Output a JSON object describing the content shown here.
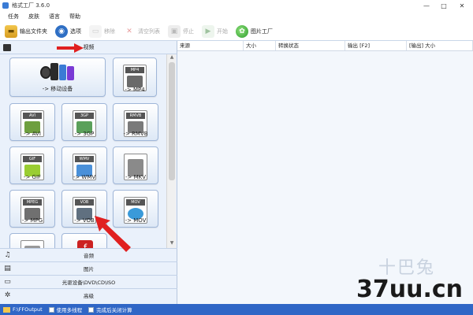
{
  "window": {
    "title": "格式工厂 3.6.0",
    "min_glyph": "—",
    "max_glyph": "□",
    "close_glyph": "✕"
  },
  "menu": [
    "任务",
    "皮肤",
    "语言",
    "帮助"
  ],
  "toolbar": [
    {
      "label": "输出文件夹",
      "icon": "folder-icon",
      "glyph": "▬",
      "enabled": true
    },
    {
      "label": "选项",
      "icon": "options-icon",
      "glyph": "◉",
      "enabled": true
    },
    {
      "label": "移除",
      "icon": "remove-icon",
      "glyph": "▭",
      "enabled": false
    },
    {
      "label": "清空列表",
      "icon": "clear-list-icon",
      "glyph": "✕",
      "enabled": false
    },
    {
      "label": "停止",
      "icon": "stop-icon",
      "glyph": "▣",
      "enabled": false
    },
    {
      "label": "开始",
      "icon": "start-icon",
      "glyph": "▶",
      "enabled": false
    },
    {
      "label": "图片工厂",
      "icon": "picture-factory-icon",
      "glyph": "✿",
      "enabled": true
    }
  ],
  "left": {
    "header": "视频",
    "tiles": [
      {
        "label": "-> 移动设备",
        "icon": "mobile-device-icon",
        "tag": "",
        "color": "#4a6a8a"
      },
      {
        "label": "-> MP4",
        "icon": "mp4-icon",
        "tag": "MP4",
        "color": "#6a6a6a"
      },
      {
        "label": "-> AVI",
        "icon": "avi-icon",
        "tag": "AVI",
        "color": "#6e9f3e"
      },
      {
        "label": "-> 3GP",
        "icon": "3gp-icon",
        "tag": "3GP",
        "color": "#5aa05a"
      },
      {
        "label": "-> RMVB",
        "icon": "rmvb-icon",
        "tag": "RMVB",
        "color": "#7a7a7a"
      },
      {
        "label": "-> GIF",
        "icon": "gif-icon",
        "tag": "GIF",
        "color": "#9acd32"
      },
      {
        "label": "-> WMV",
        "icon": "wmv-icon",
        "tag": "WMV",
        "color": "#4a90d9"
      },
      {
        "label": "-> MKV",
        "icon": "mkv-icon",
        "tag": "",
        "color": "#8a8a8a"
      },
      {
        "label": "-> MPG",
        "icon": "mpg-icon",
        "tag": "MPEG",
        "color": "#707070"
      },
      {
        "label": "-> VOB",
        "icon": "vob-icon",
        "tag": "VOB",
        "color": "#607080"
      },
      {
        "label": "-> MOV",
        "icon": "mov-icon",
        "tag": "MOV",
        "color": "#3a9ad9"
      },
      {
        "label": "",
        "icon": "swf-icon",
        "tag": "",
        "color": "#999999"
      },
      {
        "label": "",
        "icon": "flash-icon",
        "tag": "",
        "color": "#cc2222"
      }
    ],
    "categories": [
      {
        "label": "音频",
        "icon": "music-icon",
        "glyph": "♫"
      },
      {
        "label": "图片",
        "icon": "picture-icon",
        "glyph": "▤"
      },
      {
        "label": "光驱设备\\DVD\\CD\\ISO",
        "icon": "disc-drive-icon",
        "glyph": "▭"
      },
      {
        "label": "高级",
        "icon": "advanced-icon",
        "glyph": "✲"
      }
    ]
  },
  "list": {
    "columns": [
      "来源",
      "大小",
      "转换状态",
      "输出 [F2]",
      "[输出] 大小"
    ]
  },
  "status": {
    "path": "F:\\FFOutput",
    "multithread": "使用多线程",
    "shutdown": "完成后关闭计算"
  },
  "watermark": {
    "cn": "十巴兔",
    "en": "37uu.cn"
  },
  "colors": {
    "accent": "#2f66c6",
    "annotation_arrow": "#e02020"
  }
}
